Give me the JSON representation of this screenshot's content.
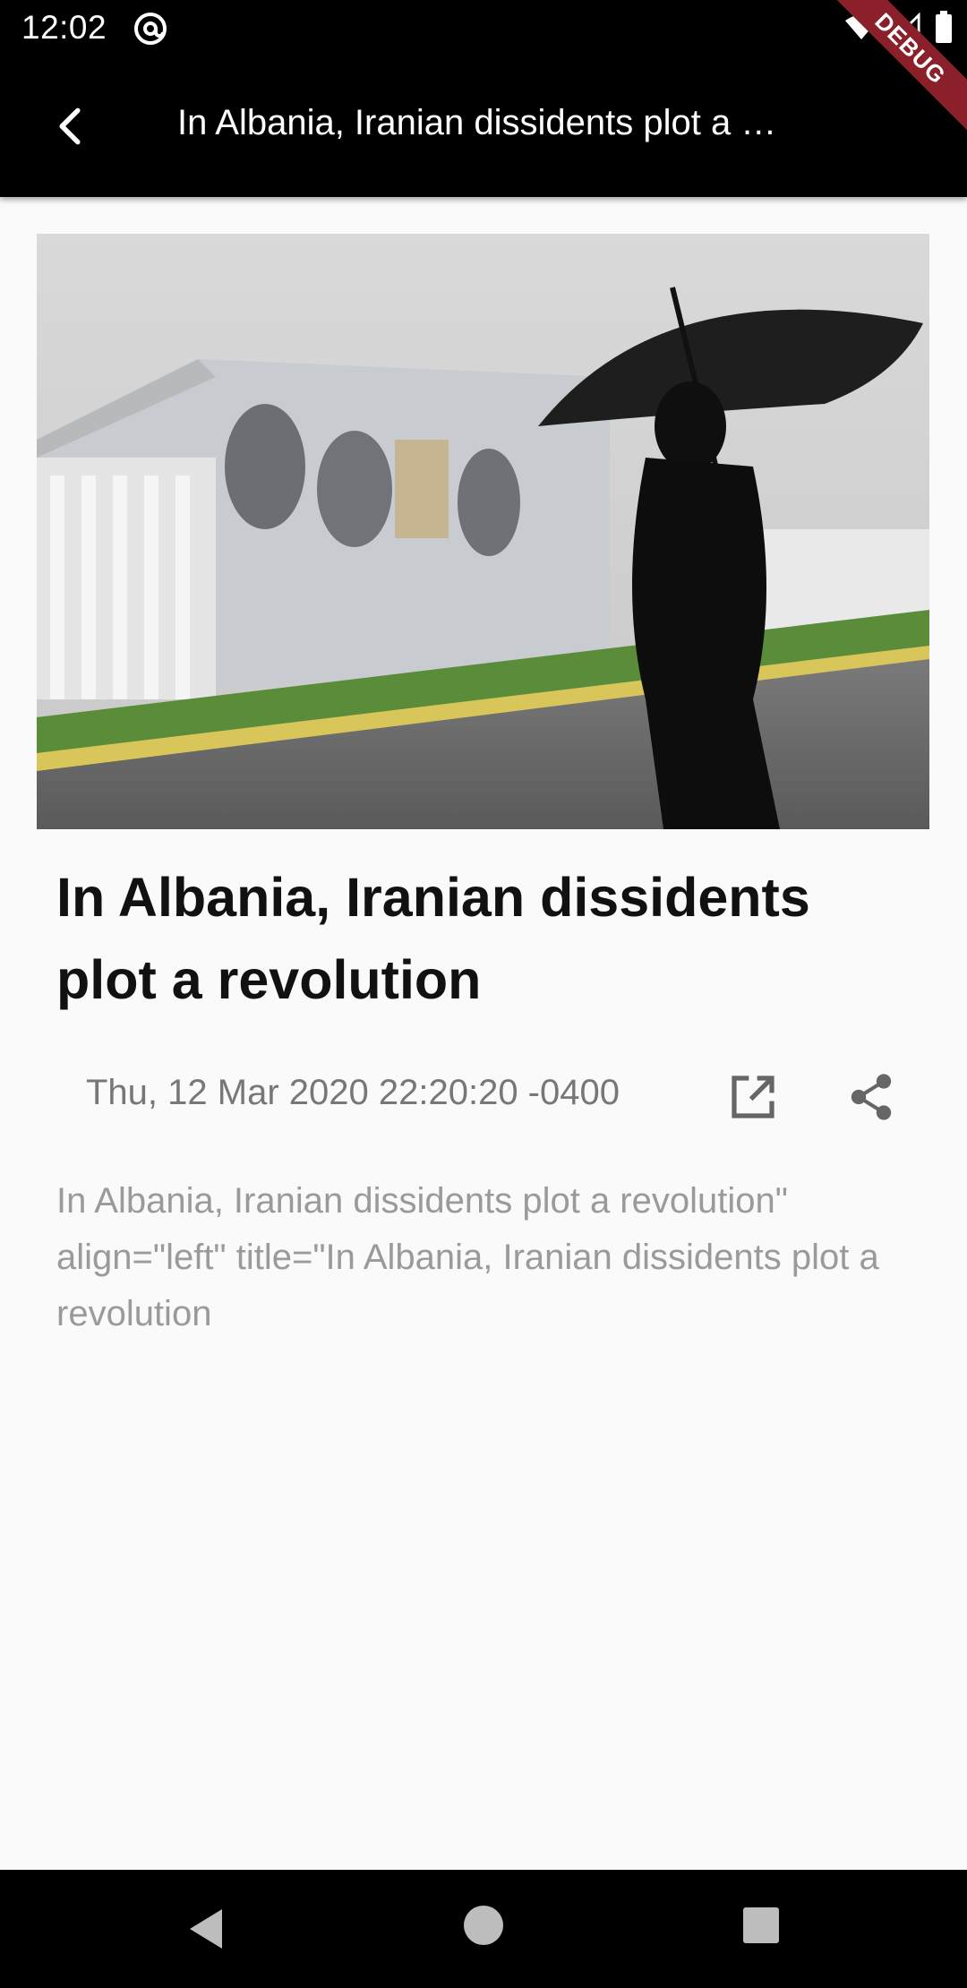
{
  "status_bar": {
    "time": "12:02",
    "icons": [
      "at-sign-icon",
      "wifi-icon",
      "cell-signal-icon",
      "battery-icon"
    ]
  },
  "debug_banner": "DEBUG",
  "app_bar": {
    "back_icon": "arrow-back-icon",
    "title": "In Albania, Iranian dissidents plot a …"
  },
  "article": {
    "image_alt": "Man holding umbrella walking past building with portrait murals",
    "title": "In Albania, Iranian dissidents plot a revolution",
    "date": "Thu, 12 Mar 2020 22:20:20 -0400",
    "open_icon": "open-in-new-icon",
    "share_icon": "share-icon",
    "body": "In Albania, Iranian dissidents plot a revolution\" align=\"left\" title=\"In Albania, Iranian dissidents plot a revolution"
  },
  "nav_bar": {
    "icons": [
      "nav-back-icon",
      "nav-home-icon",
      "nav-recents-icon"
    ]
  },
  "colors": {
    "bar_background": "#000000",
    "page_background": "#fafafa",
    "title_text": "#111111",
    "meta_text": "#777777",
    "body_text": "#9a9a9a",
    "debug_ribbon": "#8b1f2a"
  }
}
